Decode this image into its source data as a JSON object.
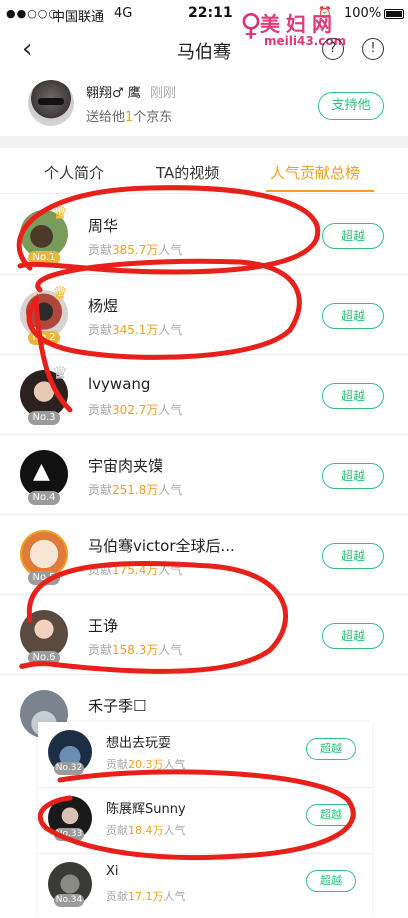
{
  "status_bar": {
    "signal": "●●○○○",
    "carrier": "中国联通",
    "network": "4G",
    "time": "22:11",
    "battery": "100%"
  },
  "watermark": {
    "text": "美妇网",
    "domain": "meili43.com"
  },
  "nav": {
    "title": "马伯骞",
    "back_icon": "chevron-left-icon",
    "question_icon": "question-icon",
    "info_icon": "info-icon"
  },
  "profile": {
    "name": "翱翔♂ 鹰",
    "time": "刚刚",
    "gift_prefix": "送给他",
    "gift_count": "1",
    "gift_suffix": "个京东",
    "support_label": "支持他"
  },
  "tabs": [
    {
      "label": "个人简介"
    },
    {
      "label": "TA的视频"
    },
    {
      "label": "人气贡献总榜"
    }
  ],
  "ranking": [
    {
      "rank": "No.1",
      "name": "周华",
      "contrib_prefix": "贡献",
      "value": "385.7万",
      "suffix": "人气",
      "button": "超越"
    },
    {
      "rank": "No.2",
      "name": "杨煜",
      "contrib_prefix": "贡献",
      "value": "345.1万",
      "suffix": "人气",
      "button": "超越"
    },
    {
      "rank": "No.3",
      "name": "lvywang",
      "contrib_prefix": "贡献",
      "value": "302.7万",
      "suffix": "人气",
      "button": "超越"
    },
    {
      "rank": "No.4",
      "name": "宇宙肉夹馍",
      "contrib_prefix": "贡献",
      "value": "251.8万",
      "suffix": "人气",
      "button": "超越"
    },
    {
      "rank": "No.5",
      "name": "马伯骞victor全球后...",
      "contrib_prefix": "贡献",
      "value": "175.4万",
      "suffix": "人气",
      "button": "超越"
    },
    {
      "rank": "No.6",
      "name": "王诤",
      "contrib_prefix": "贡献",
      "value": "158.3万",
      "suffix": "人气",
      "button": "超越"
    },
    {
      "rank": "No.7",
      "name": "禾子季☐"
    }
  ],
  "sub_ranking": [
    {
      "rank": "No.32",
      "name": "想出去玩耍",
      "contrib_prefix": "贡献",
      "value": "20.3万",
      "suffix": "人气",
      "button": "超越"
    },
    {
      "rank": "No.33",
      "name": "陈展辉Sunny",
      "contrib_prefix": "贡献",
      "value": "18.4万",
      "suffix": "人气",
      "button": "超越"
    },
    {
      "rank": "No.34",
      "name": "Xi",
      "contrib_prefix": "贡献",
      "value": "17.1万",
      "suffix": "人气",
      "button": "超越"
    }
  ],
  "colors": {
    "accent": "#f0a020",
    "green": "#31c27c",
    "scribble": "#e8201a"
  }
}
